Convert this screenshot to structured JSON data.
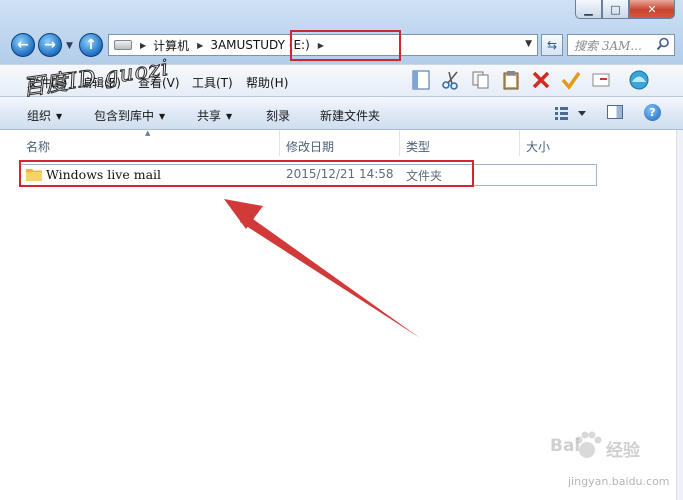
{
  "window": {
    "controls": {
      "minimize_icon": "minimize-icon",
      "maximize_icon": "maximize-icon",
      "close_icon": "close-icon"
    }
  },
  "address_bar": {
    "breadcrumbs": [
      "计算机",
      "3AMUSTUDY (E:)"
    ],
    "search_placeholder": "搜索 3AM..."
  },
  "menu": {
    "items": [
      "文件(F)",
      "编辑(E)",
      "查看(V)",
      "工具(T)",
      "帮助(H)"
    ]
  },
  "command_bar": {
    "organize": "组织",
    "include_in_library": "包含到库中",
    "share": "共享",
    "burn": "刻录",
    "new_folder": "新建文件夹"
  },
  "columns": {
    "name": "名称",
    "modified": "修改日期",
    "type": "类型",
    "size": "大小"
  },
  "files": [
    {
      "name": "Windows live mail",
      "modified": "2015/12/21 14:58",
      "type": "文件夹",
      "size": ""
    }
  ],
  "annotations": {
    "watermark_text": "百度ID  guozi",
    "baidu_mark": "Bai",
    "baidu_jingyan": "经验",
    "baidu_url": "jingyan.baidu.com",
    "highlight_color": "#d0262f"
  }
}
